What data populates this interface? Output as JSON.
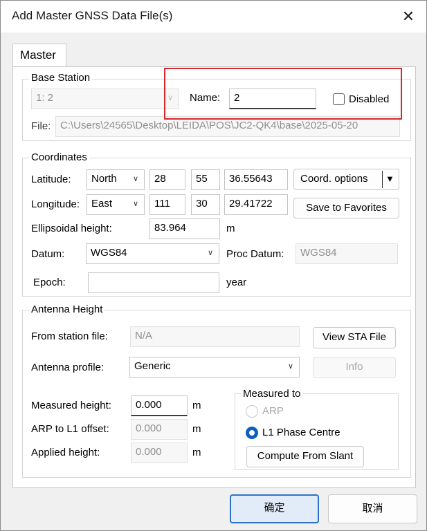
{
  "window": {
    "title": "Add Master GNSS Data File(s)",
    "close_icon": "close-icon"
  },
  "tabs": [
    {
      "label": "Master",
      "active": true
    }
  ],
  "base_station": {
    "group_label": "Base Station",
    "station_select": "1: 2",
    "name_label": "Name:",
    "name_value": "2",
    "disabled_label": "Disabled",
    "disabled_checked": false,
    "file_label": "File:",
    "file_value": "C:\\Users\\24565\\Desktop\\LEIDA\\POS\\JC2-QK4\\base\\2025-05-20"
  },
  "coordinates": {
    "group_label": "Coordinates",
    "latitude_label": "Latitude:",
    "latitude_hemisphere": "North",
    "latitude_deg": "28",
    "latitude_min": "55",
    "latitude_sec": "36.55643",
    "longitude_label": "Longitude:",
    "longitude_hemisphere": "East",
    "longitude_deg": "111",
    "longitude_min": "30",
    "longitude_sec": "29.41722",
    "coord_options_label": "Coord. options",
    "save_favorites_label": "Save to Favorites",
    "ellipsoidal_label": "Ellipsoidal height:",
    "ellipsoidal_value": "83.964",
    "ellipsoidal_unit": "m",
    "datum_label": "Datum:",
    "datum_value": "WGS84",
    "proc_datum_label": "Proc Datum:",
    "proc_datum_value": "WGS84",
    "epoch_label": "Epoch:",
    "epoch_value": "",
    "epoch_unit": "year"
  },
  "antenna": {
    "group_label": "Antenna Height",
    "from_station_label": "From station file:",
    "from_station_value": "N/A",
    "view_sta_label": "View STA File",
    "profile_label": "Antenna profile:",
    "profile_value": "Generic",
    "info_label": "Info",
    "measured_label": "Measured height:",
    "measured_value": "0.000",
    "measured_unit": "m",
    "arp_offset_label": "ARP to L1 offset:",
    "arp_offset_value": "0.000",
    "arp_offset_unit": "m",
    "applied_label": "Applied height:",
    "applied_value": "0.000",
    "applied_unit": "m",
    "measured_to": {
      "group_label": "Measured to",
      "options": [
        {
          "label": "ARP",
          "selected": false,
          "enabled": false
        },
        {
          "label": "L1 Phase Centre",
          "selected": true,
          "enabled": true
        }
      ],
      "compute_slant_label": "Compute From Slant"
    }
  },
  "footer": {
    "ok_label": "确定",
    "cancel_label": "取消"
  }
}
